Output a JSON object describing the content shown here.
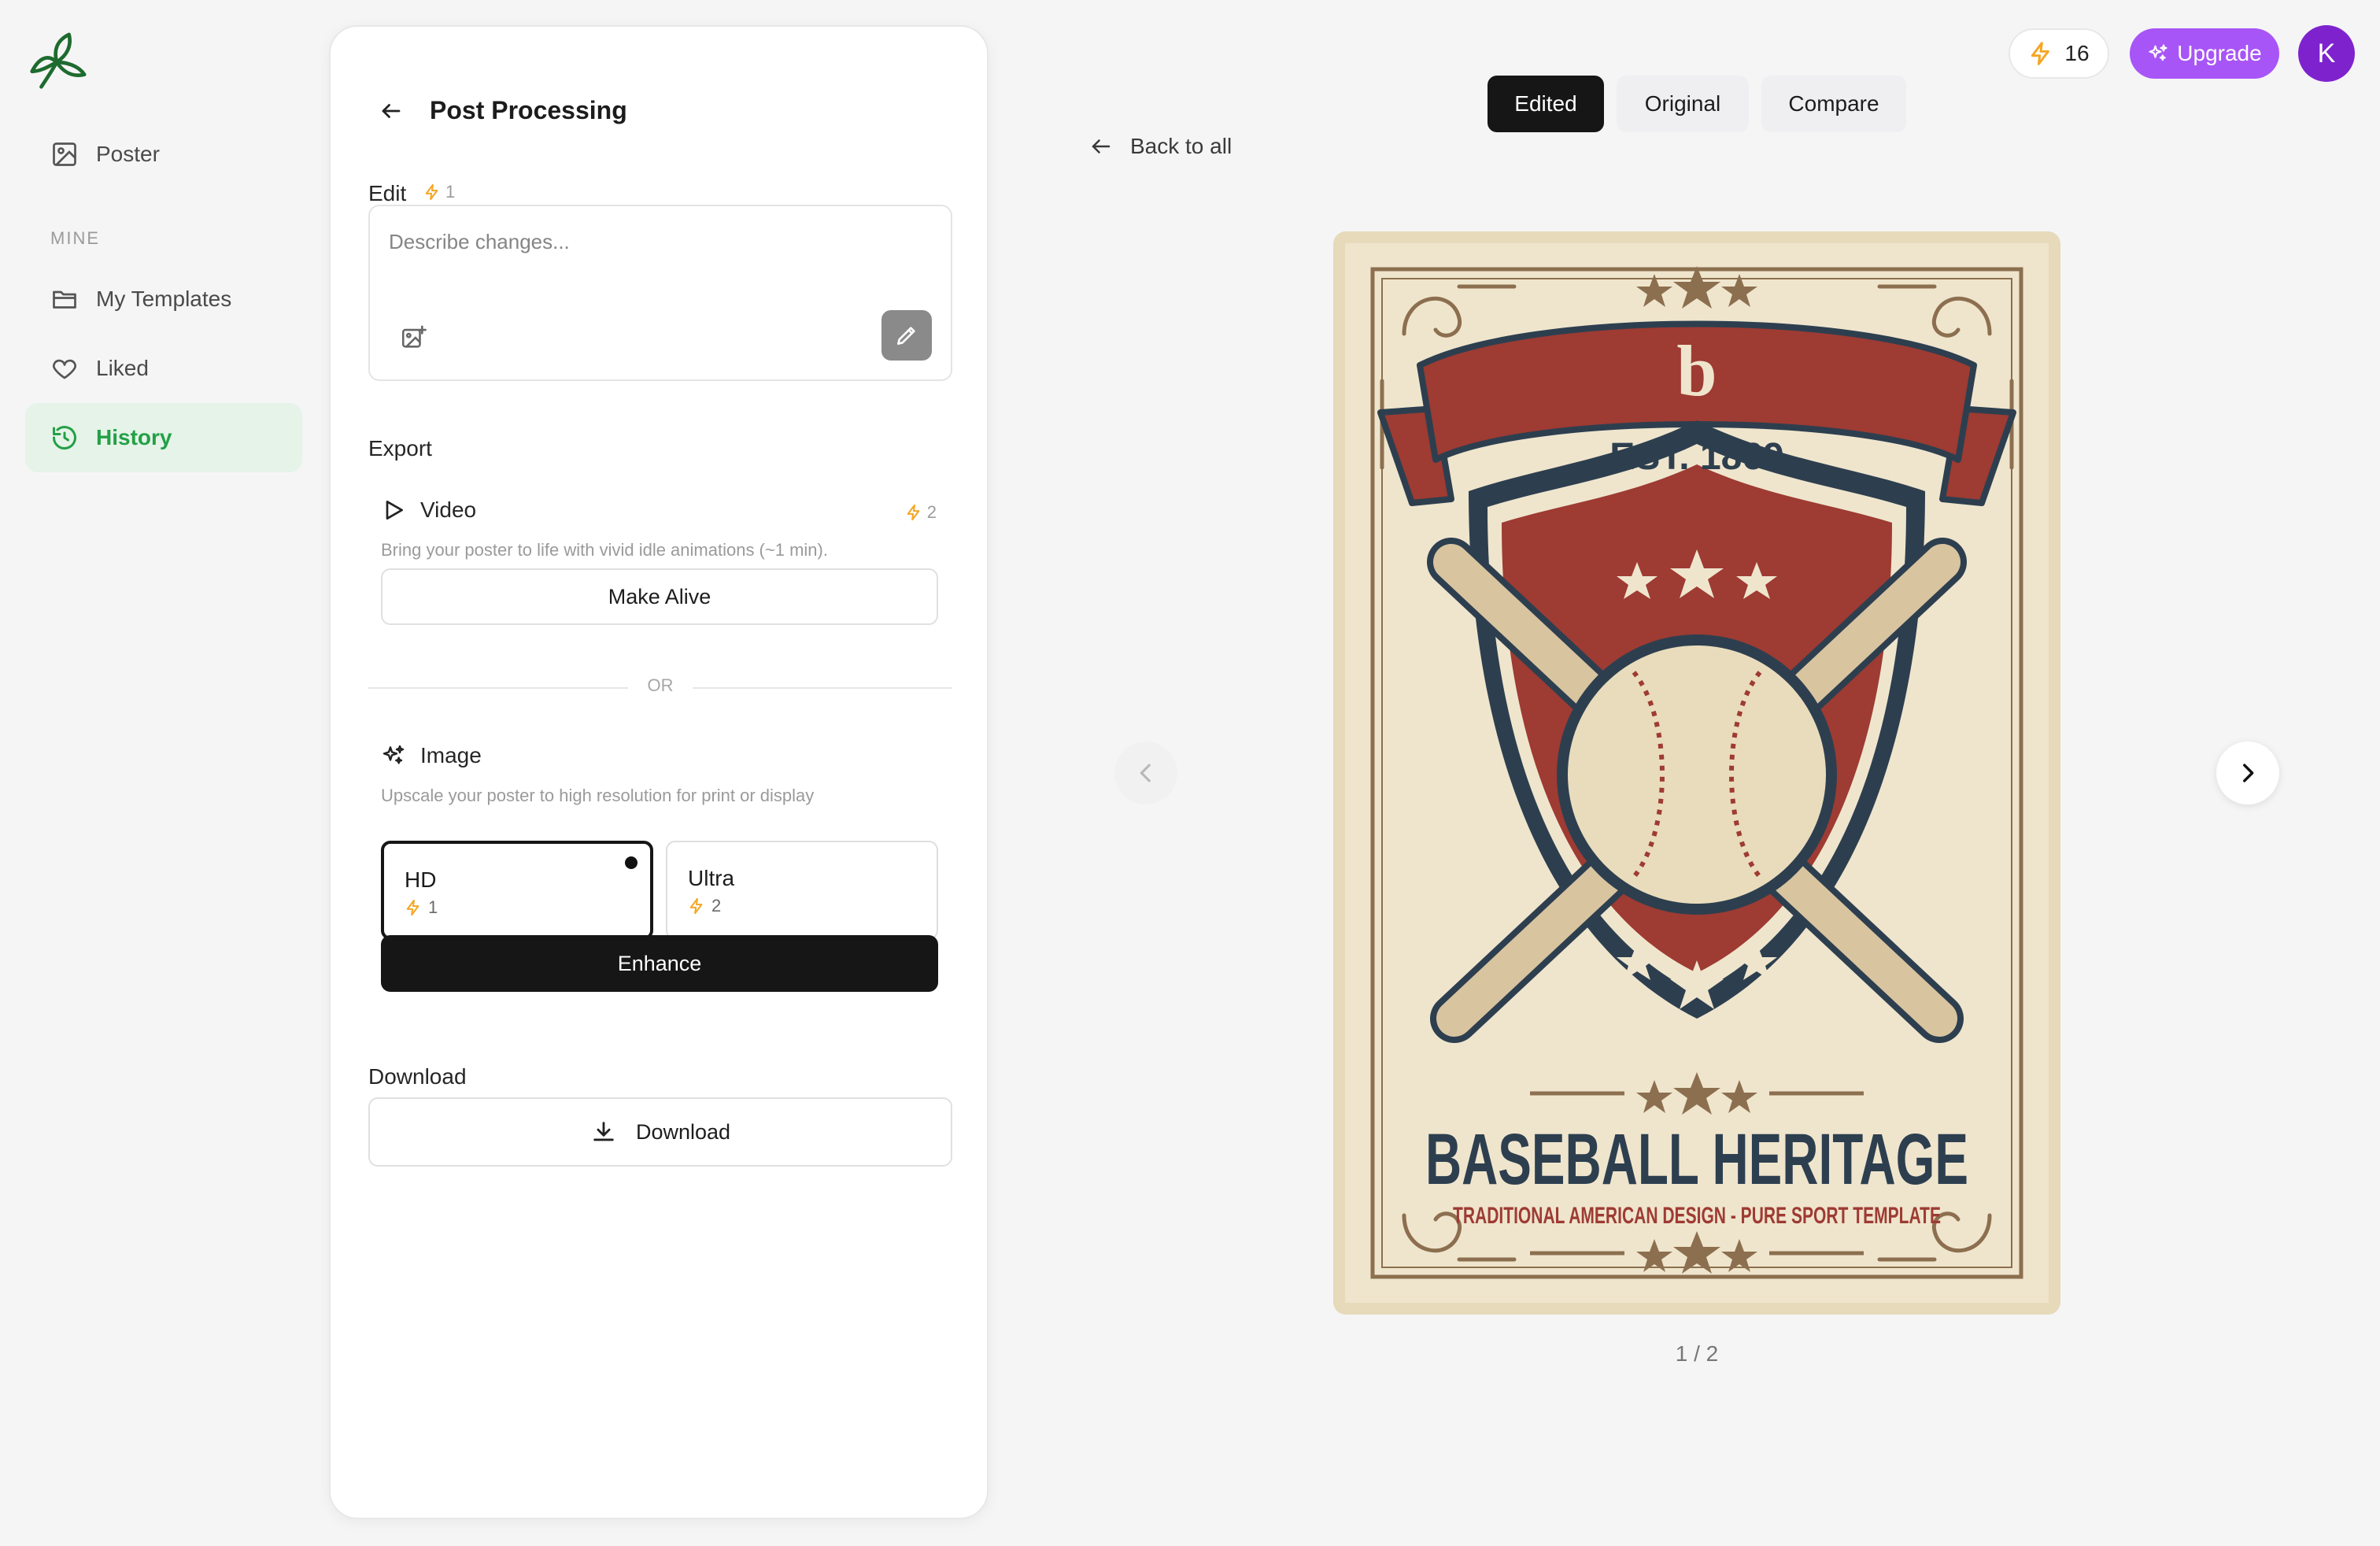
{
  "nav": {
    "items": [
      {
        "label": "Poster",
        "icon": "image-icon"
      },
      {
        "label": "My Templates",
        "icon": "folder-icon"
      },
      {
        "label": "Liked",
        "icon": "heart-icon"
      },
      {
        "label": "History",
        "icon": "history-icon",
        "active": true
      }
    ],
    "section_label": "MINE"
  },
  "panel": {
    "title": "Post Processing",
    "edit": {
      "label": "Edit",
      "cost": "1",
      "placeholder": "Describe changes..."
    },
    "export_label": "Export",
    "video": {
      "title": "Video",
      "cost": "2",
      "description": "Bring your poster to life with vivid idle animations (~1 min).",
      "button": "Make Alive"
    },
    "or_text": "OR",
    "image": {
      "title": "Image",
      "description": "Upscale your poster to high resolution for print or display",
      "options": [
        {
          "name": "HD",
          "cost": "1",
          "selected": true
        },
        {
          "name": "Ultra",
          "cost": "2",
          "selected": false
        }
      ],
      "button": "Enhance"
    },
    "download": {
      "label": "Download",
      "button": "Download"
    }
  },
  "header": {
    "credits": "16",
    "upgrade_label": "Upgrade",
    "avatar_initial": "K"
  },
  "viewer": {
    "tabs": [
      {
        "label": "Edited",
        "active": true
      },
      {
        "label": "Original",
        "active": false
      },
      {
        "label": "Compare",
        "active": false
      }
    ],
    "back_label": "Back to all",
    "page_indicator": "1 / 2"
  },
  "poster": {
    "logo_letter": "b",
    "est": "EST. 1869",
    "headline": "BASEBALL HERITAGE",
    "tagline": "TRADITIONAL AMERICAN DESIGN - PURE SPORT TEMPLATE"
  },
  "colors": {
    "accent_green": "#23a046",
    "upgrade_purple": "#a855f7",
    "avatar_purple": "#7e22ce",
    "bolt_amber": "#f5a623",
    "poster_red": "#9e3b33",
    "poster_navy": "#2d3f4f",
    "poster_cream": "#efe5cd"
  }
}
